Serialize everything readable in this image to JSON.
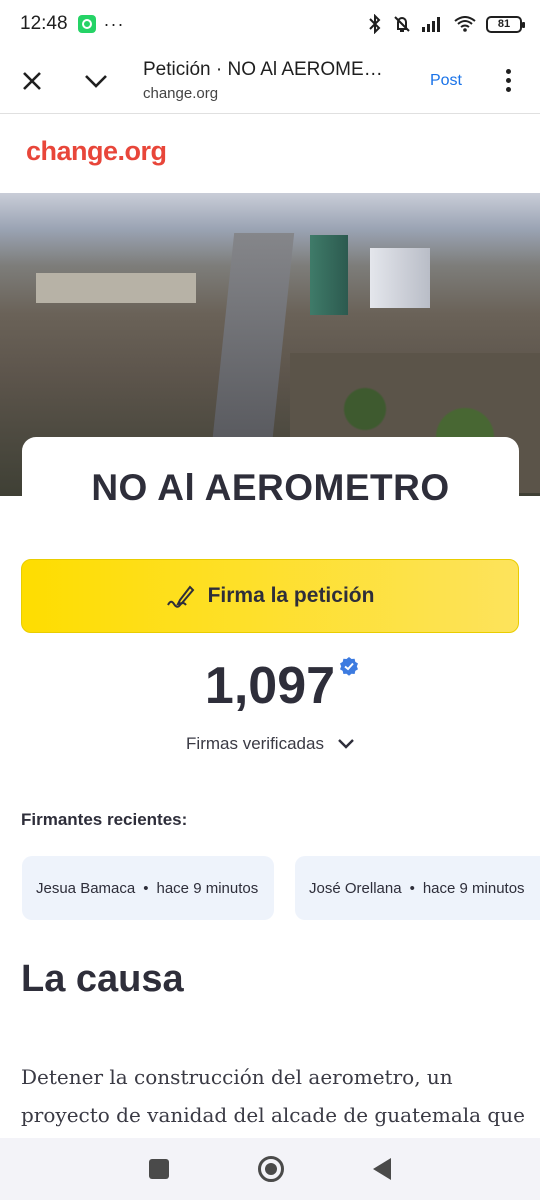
{
  "status_bar": {
    "time": "12:48",
    "battery": "81",
    "icons": [
      "whatsapp-icon",
      "more-dots-icon",
      "bluetooth-icon",
      "mute-icon",
      "signal-icon",
      "wifi-icon",
      "battery-icon"
    ]
  },
  "toolbar": {
    "title": "Petición · NO Al AEROMETRO",
    "url": "change.org",
    "post_label": "Post",
    "icons": [
      "close-icon",
      "chevron-down-icon",
      "overflow-menu-icon"
    ]
  },
  "page": {
    "brand": "change.org",
    "petition_title": "NO Al AEROMETRO",
    "sign_button_label": "Firma la petición",
    "signature_count": "1,097",
    "verified_label": "Firmas verificadas",
    "recent_signers_label": "Firmantes recientes:",
    "recent_signers": [
      {
        "name": "Jesua Bamaca",
        "time": "hace 9 minutos"
      },
      {
        "name": "José Orellana",
        "time": "hace 9 minutos"
      }
    ],
    "cause_title": "La causa",
    "cause_text": "Detener la construcción del aerometro, un proyecto de vanidad del alcade de guatemala que"
  },
  "colors": {
    "brand_red": "#e8463a",
    "sign_yellow": "#fedd00",
    "verified_blue": "#3d7be0",
    "link_blue": "#1a73e8"
  }
}
